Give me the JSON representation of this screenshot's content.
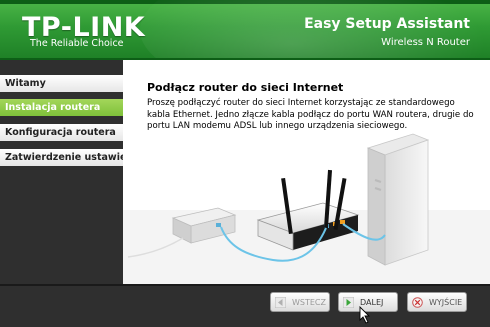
{
  "header": {
    "logo": "TP-LINK",
    "tagline": "The Reliable Choice",
    "title": "Easy Setup Assistant",
    "subtitle": "Wireless N Router"
  },
  "sidebar": {
    "items": [
      {
        "label": "Witamy",
        "active": false
      },
      {
        "label": "Instalacja routera",
        "active": true
      },
      {
        "label": "Konfiguracja routera",
        "active": false
      },
      {
        "label": "Zatwierdzenie ustawień",
        "active": false
      }
    ]
  },
  "content": {
    "title": "Podłącz router do sieci Internet",
    "description": "Proszę podłączyć router do sieci Internet korzystając ze standardowego kabla Ethernet. Jedno złącze kabla podłącz do portu WAN routera, drugie do portu LAN modemu ADSL lub innego urządzenia sieciowego."
  },
  "footer": {
    "back_label": "WSTECZ",
    "next_label": "DALEJ",
    "exit_label": "WYJŚCIE"
  },
  "colors": {
    "brand_green": "#2f9a34",
    "active_nav": "#8cc63f",
    "dark_panel": "#2f2f2f"
  }
}
